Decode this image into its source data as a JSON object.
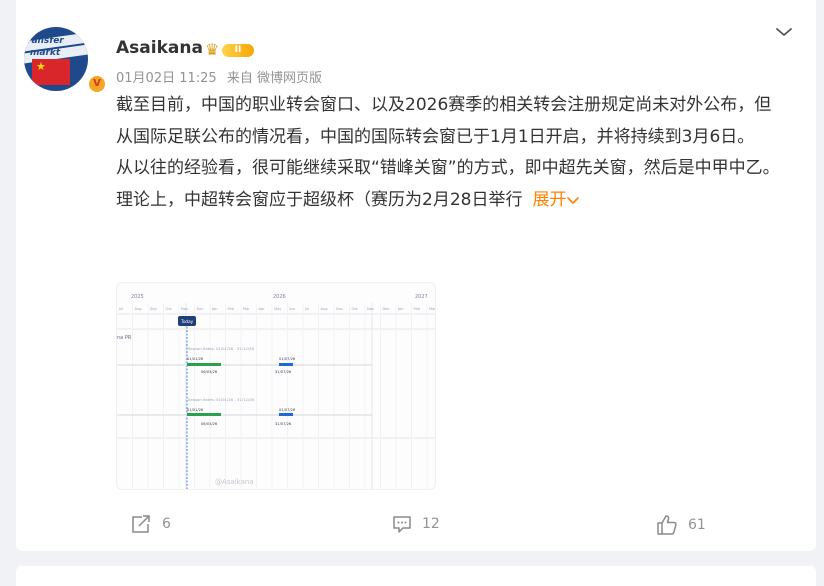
{
  "post": {
    "author": {
      "name": "Asaikana",
      "avatar_text_line1": "ransfer",
      "avatar_text_line2": "markt",
      "level": "II"
    },
    "meta": {
      "date": "01月02日 11:25",
      "source": "来自 微博网页版"
    },
    "paragraphs": [
      "截至目前，中国的职业转会窗口、以及2026赛季的相关转会注册规定尚未对外公布，但从国际足联公布的情况看，中国的国际转会窗已于1月1日开启，并将持续到3月6日。",
      "从以往的经验看，很可能继续采取“错峰关窗”的方式，即中超先关窗，然后是中甲中乙。",
      "理论上，中超转会窗应于超级杯（赛历为2月28日举行"
    ],
    "expand_label": "展开",
    "image": {
      "years": [
        "2025",
        "2026",
        "2027"
      ],
      "months": [
        "Jul",
        "Aug",
        "Sep",
        "Oct",
        "Nov",
        "Dec",
        "Jan",
        "Feb",
        "Mar",
        "Apr",
        "May",
        "Jun",
        "Jul",
        "Aug",
        "Sep",
        "Oct",
        "Nov",
        "Dec",
        "Jan",
        "Feb",
        "Mar",
        "Apr"
      ],
      "today_label": "Today",
      "row_label": "na PR",
      "season1_label": "Season dates: 01/01/26 - 31/12/26",
      "season2_label": "Season dates: 01/01/26 - 31/12/26",
      "bar1_start": "01/01/26",
      "bar1_end": "06/03/26",
      "bar2_start": "01/07/26",
      "bar2_end": "31/07/26",
      "bar3_start": "01/01/26",
      "bar3_end": "06/03/26",
      "bar4_start": "01/07/26",
      "bar4_end": "31/07/26",
      "watermark": "@Asaikana"
    },
    "actions": {
      "share_count": "6",
      "comment_count": "12",
      "like_count": "61"
    }
  },
  "colors": {
    "accent": "#ff8200",
    "muted": "#939393",
    "background": "#f1f2f5",
    "timeline_blue": "#1f6ad1",
    "timeline_green": "#2aa14a"
  }
}
